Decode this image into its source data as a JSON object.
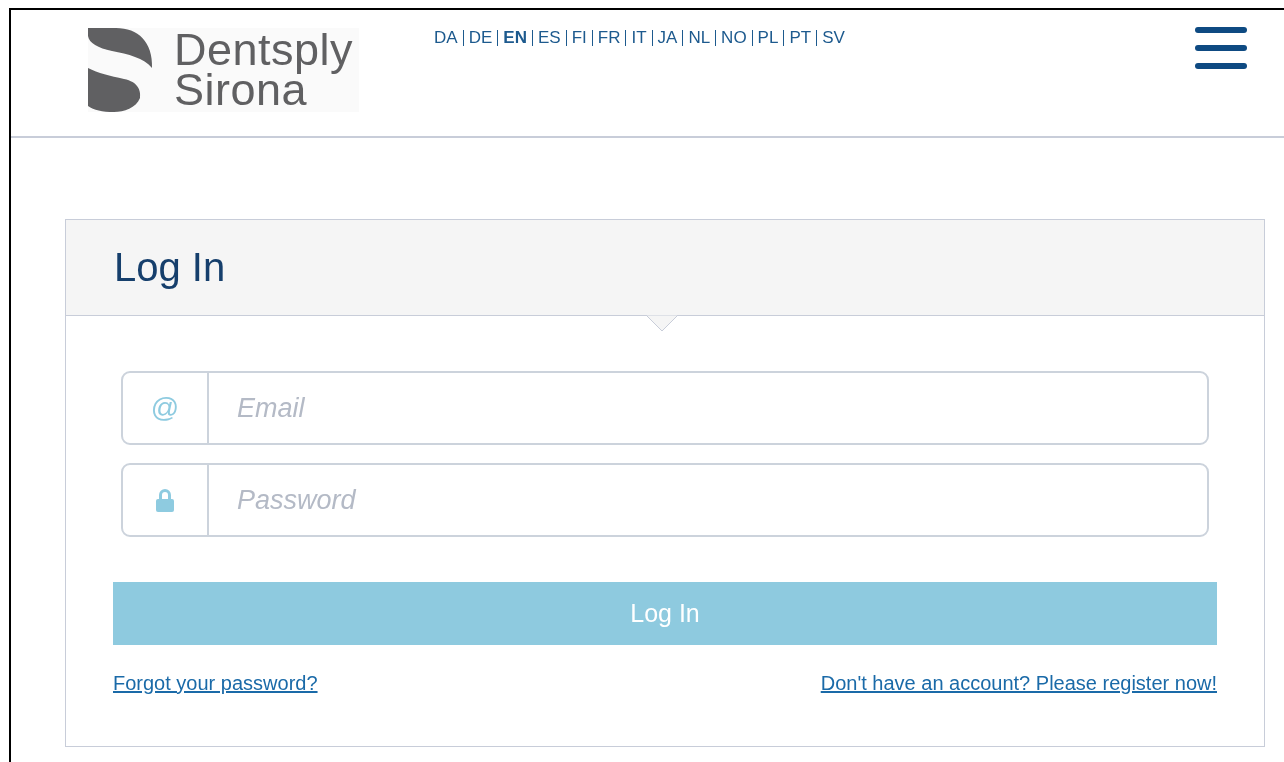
{
  "logo": {
    "line1": "Dentsply",
    "line2": "Sirona"
  },
  "languages": [
    {
      "label": "DA",
      "selected": false
    },
    {
      "label": "DE",
      "selected": false
    },
    {
      "label": "EN",
      "selected": true
    },
    {
      "label": "ES",
      "selected": false
    },
    {
      "label": "FI",
      "selected": false
    },
    {
      "label": "FR",
      "selected": false
    },
    {
      "label": "IT",
      "selected": false
    },
    {
      "label": "JA",
      "selected": false
    },
    {
      "label": "NL",
      "selected": false
    },
    {
      "label": "NO",
      "selected": false
    },
    {
      "label": "PL",
      "selected": false
    },
    {
      "label": "PT",
      "selected": false
    },
    {
      "label": "SV",
      "selected": false
    }
  ],
  "login": {
    "title": "Log In",
    "fields": [
      {
        "kind": "email",
        "icon": "@",
        "placeholder": "Email"
      },
      {
        "kind": "password",
        "placeholder": "Password"
      }
    ],
    "button": "Log In",
    "forgot_link": "Forgot your password?",
    "register_link": "Don't have an account? Please register now!"
  }
}
